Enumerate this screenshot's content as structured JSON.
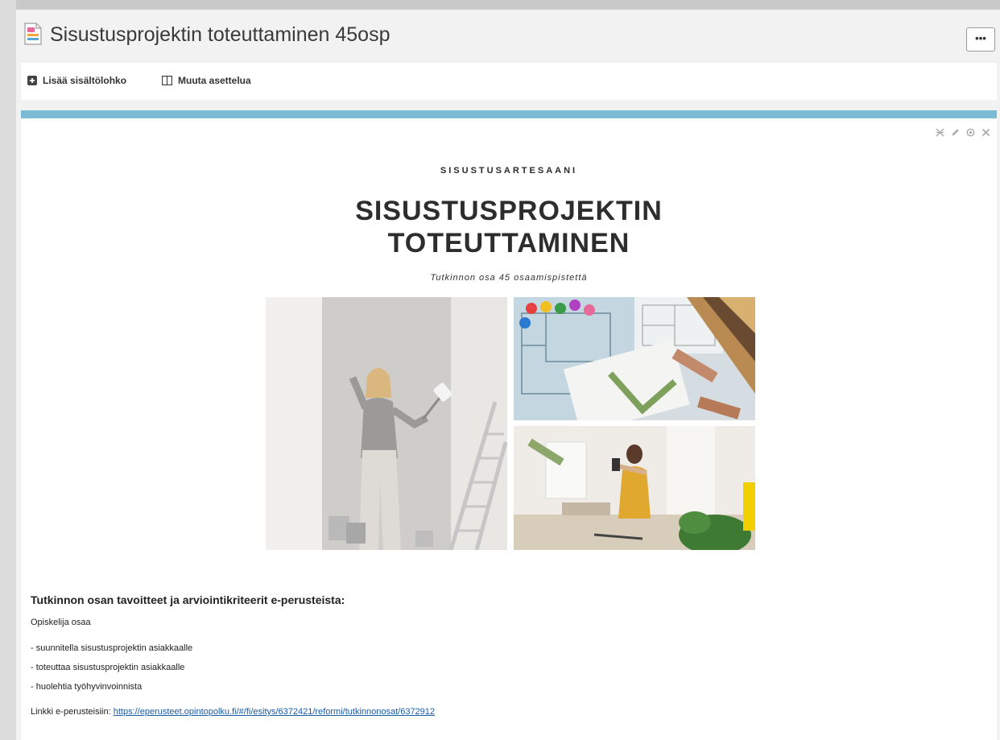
{
  "page": {
    "title": "Sisustusprojektin toteuttaminen 45osp",
    "more_label": "•••"
  },
  "toolbar": {
    "add_block_label": "Lisää sisältölohko",
    "change_layout_label": "Muuta asettelua"
  },
  "poster": {
    "kicker": "SISUSTUSARTESAANI",
    "title_line1": "SISUSTUSPROJEKTIN",
    "title_line2": "TOTEUTTAMINEN",
    "subtitle": "Tutkinnon osa 45 osaamispistettä"
  },
  "content": {
    "heading": "Tutkinnon osan tavoitteet ja arviointikriteerit e-perusteista:",
    "intro": "Opiskelija osaa",
    "items": [
      "- suunnitella sisustusprojektin asiakkaalle",
      "- toteuttaa sisustusprojektin asiakkaalle",
      "- huolehtia työhyvinvoinnista"
    ],
    "link_prefix": "Linkki e-perusteisiin: ",
    "link_text": "https://eperusteet.opintopolku.fi/#/fi/esitys/6372421/reformi/tutkinnonosat/6372912"
  },
  "colors": {
    "accent_bar": "#7bbbd4",
    "link": "#1a5aa6"
  }
}
